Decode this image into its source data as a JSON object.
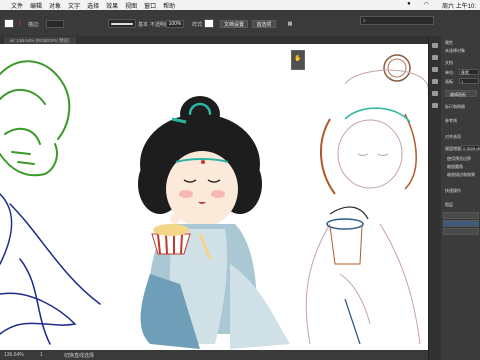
{
  "menubar": {
    "items": [
      "文件",
      "编辑",
      "对象",
      "文字",
      "选择",
      "效果",
      "视图",
      "窗口",
      "帮助"
    ],
    "clock": "周六 上午10:"
  },
  "control": {
    "stroke_label": "描边:",
    "basic_label": "基本",
    "opacity_label": "不透明度:",
    "opacity_value": "100%",
    "style_label": "样式:",
    "doc_setup": "文档设置",
    "prefs": "首选项"
  },
  "doc_tab": "ai* 136.64% (RGB/GPU 预览)",
  "status": {
    "zoom": "136.64%",
    "page": "1",
    "tool": "切换直线选择"
  },
  "panel": {
    "properties_label": "属性",
    "no_selection": "未选择对象",
    "doc_label": "文档",
    "unit_label": "单位:",
    "unit_value": "像素",
    "artboard_label": "画板:",
    "artboard_value": "1",
    "edit_artboard": "编辑画板",
    "ruler_grid": "标尺和网格",
    "guides": "参考线",
    "snap_label": "对齐选项",
    "keyboard_inc_label": "键盘增量:",
    "keyboard_inc_value": "0.3528 m",
    "use_preview": "使用预览边界",
    "scale_corner": "缩放圆角",
    "scale_stroke": "缩放描边和效果",
    "quick_actions": "快速操作",
    "layers_label": "图层"
  },
  "colors": {
    "accent": "#2d8cf0",
    "canvas": "#ffffff",
    "ui_dark": "#3a3a3a"
  }
}
